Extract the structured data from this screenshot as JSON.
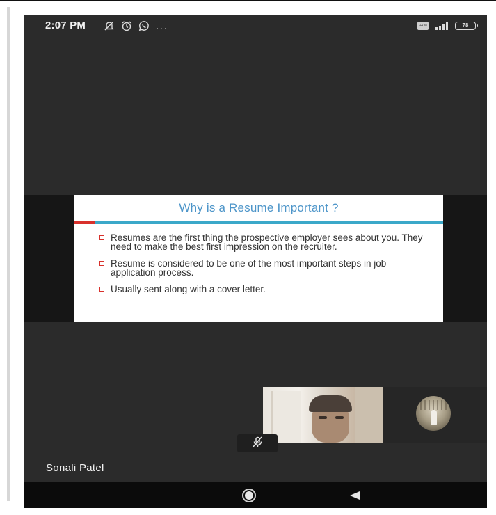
{
  "status_bar": {
    "time": "2:07 PM",
    "volte_label": "VoLTE",
    "battery_level": "78",
    "more_indicator": "···",
    "icons": [
      "notifications-off-icon",
      "alarm-icon",
      "whatsapp-icon",
      "volte-icon",
      "signal-icon",
      "battery-icon"
    ]
  },
  "slide": {
    "title": "Why is a Resume Important ?",
    "bullets": [
      "Resumes are the first thing the prospective employer sees about you. They need to make the best first impression on the recruiter.",
      "Resume is considered to be one of the most important steps in job application process.",
      "Usually sent along with a cover letter."
    ],
    "accent_colors": {
      "title": "#4d95c9",
      "rule": "#3ba8c9",
      "marker": "#d8312c"
    }
  },
  "video": {
    "participant_name": "Sonali Patel",
    "mic_state_icon": "mic-off-icon"
  },
  "nav_bar": {
    "icons": [
      "home-icon",
      "back-icon"
    ]
  }
}
